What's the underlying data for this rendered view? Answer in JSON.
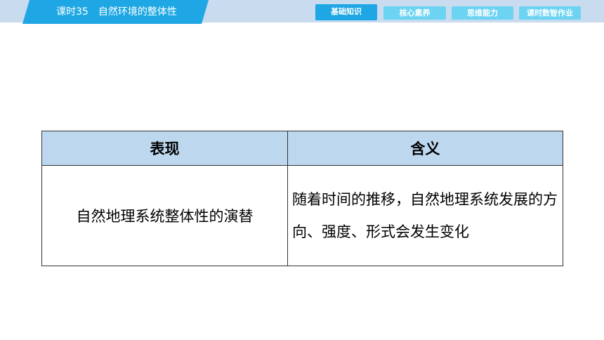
{
  "header": {
    "lesson_title": "课时35　自然环境的整体性",
    "tabs": [
      {
        "label": "基础知识",
        "active": true
      },
      {
        "label": "核心素养",
        "active": false
      },
      {
        "label": "思维能力",
        "active": false
      },
      {
        "label": "课时数智作业",
        "active": false
      }
    ]
  },
  "table": {
    "headers": [
      "表现",
      "含义"
    ],
    "rows": [
      [
        "自然地理系统整体性的演替",
        "随着时间的推移，自然地理系统发展的方向、强度、形式会发生变化"
      ]
    ]
  },
  "colors": {
    "accent": "#1ea7e4",
    "tab_inactive": "#6cd3f3",
    "topbar": "#c9dcef",
    "table_header": "#bdd7ee"
  }
}
